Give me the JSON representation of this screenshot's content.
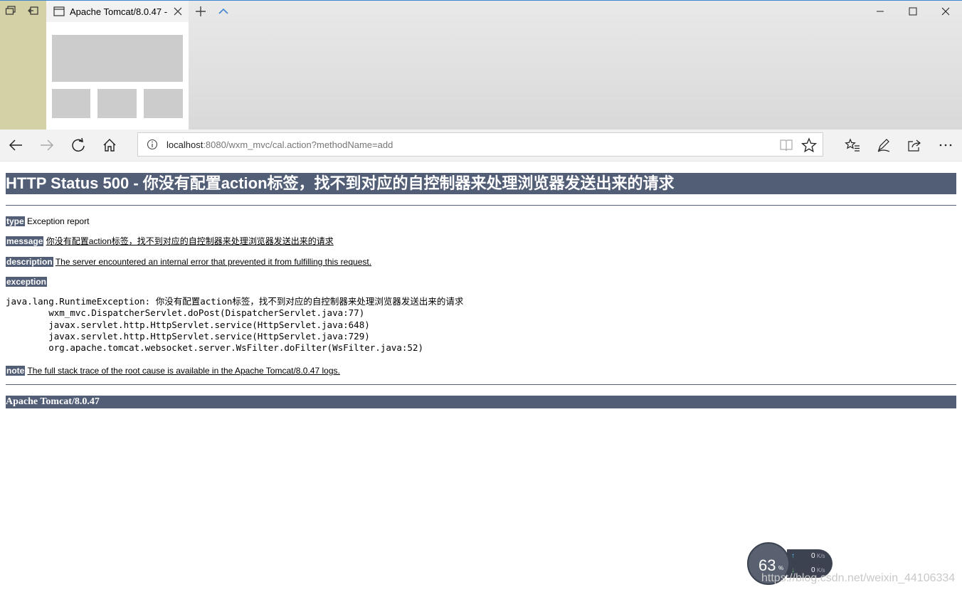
{
  "browser": {
    "tab_title": "Apache Tomcat/8.0.47 -",
    "address": {
      "host": "localhost",
      "rest": ":8080/wxm_mvc/cal.action?methodName=add"
    }
  },
  "page": {
    "h1": "HTTP Status 500 - 你没有配置action标签，找不到对应的自控制器来处理浏览器发送出来的请求",
    "type_label": "type",
    "type_value": "Exception report",
    "message_label": "message",
    "message_value": "你没有配置action标签，找不到对应的自控制器来处理浏览器发送出来的请求",
    "description_label": "description",
    "description_value": "The server encountered an internal error that prevented it from fulfilling this request.",
    "exception_label": "exception",
    "stack": [
      "java.lang.RuntimeException: 你没有配置action标签，找不到对应的自控制器来处理浏览器发送出来的请求",
      "\twxm_mvc.DispatcherServlet.doPost(DispatcherServlet.java:77)",
      "\tjavax.servlet.http.HttpServlet.service(HttpServlet.java:648)",
      "\tjavax.servlet.http.HttpServlet.service(HttpServlet.java:729)",
      "\torg.apache.tomcat.websocket.server.WsFilter.doFilter(WsFilter.java:52)"
    ],
    "note_label": "note",
    "note_value": "The full stack trace of the root cause is available in the Apache Tomcat/8.0.47 logs.",
    "footer": "Apache Tomcat/8.0.47"
  },
  "overlay": {
    "gauge_value": "63",
    "gauge_unit": "%",
    "up_speed": "0",
    "down_speed": "0",
    "speed_unit": "K/s",
    "watermark": "https://blog.csdn.net/weixin_44106334"
  },
  "colors": {
    "tomcat_header": "#525d76",
    "accent": "#3f86d0"
  },
  "icons": [
    "tabs-icon",
    "set-aside-icon",
    "page-icon",
    "close-icon",
    "plus-icon",
    "chevron-up-icon",
    "minimize-icon",
    "maximize-icon",
    "back-icon",
    "forward-icon",
    "refresh-icon",
    "home-icon",
    "info-icon",
    "reading-view-icon",
    "star-icon",
    "favorites-icon",
    "pen-icon",
    "share-icon",
    "more-icon"
  ]
}
